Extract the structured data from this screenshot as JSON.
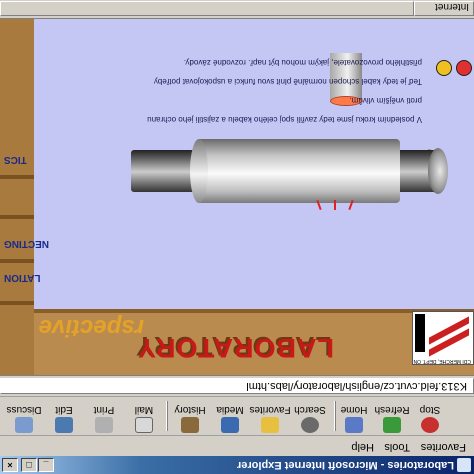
{
  "window": {
    "title": "Laboratories - Microsoft Internet Explorer",
    "controls": [
      "minimize",
      "maximize",
      "close"
    ]
  },
  "menu": [
    "Favorites",
    "Tools",
    "Help"
  ],
  "toolbar": {
    "buttons": [
      {
        "label": "Stop",
        "icon": "stop-icon"
      },
      {
        "label": "Refresh",
        "icon": "refresh-icon"
      },
      {
        "label": "Home",
        "icon": "home-icon"
      },
      {
        "label": "Search",
        "icon": "search-icon"
      },
      {
        "label": "Favorites",
        "icon": "favorites-icon"
      },
      {
        "label": "Media",
        "icon": "media-icon"
      },
      {
        "label": "History",
        "icon": "history-icon"
      },
      {
        "label": "Mail",
        "icon": "mail-icon"
      },
      {
        "label": "Print",
        "icon": "print-icon"
      },
      {
        "label": "Edit",
        "icon": "edit-icon"
      },
      {
        "label": "Discuss",
        "icon": "discuss-icon"
      }
    ]
  },
  "address": {
    "url": "K313.feld.cvut.cz/english/laboratory/labs.html"
  },
  "page": {
    "heading": "LABORATORY",
    "subheading": "rspective",
    "sidebar_labels": [
      "TICS",
      "NECTING",
      "LATION"
    ],
    "instructions": [
      "V posledním kroku jsme tedy zavřili spoj celého kabelu a zajistili jeho ochranu",
      "proti vnějším vlivům.",
      "Teď je tedy kabel schopen normálně plnit svou funkci a  uspokojovat potřeby",
      "přistihlého provozovatele, jakým mohou být např. rozvodné závody."
    ],
    "logo_caption": "CDI MERCHE, DEPT. ON"
  },
  "colors": {
    "content_bg": "#c4c7f4",
    "heading_red": "#c81818",
    "subheading_orange": "#e6a228",
    "wood": "#b98b4e"
  },
  "status": {
    "text": "Internet"
  }
}
